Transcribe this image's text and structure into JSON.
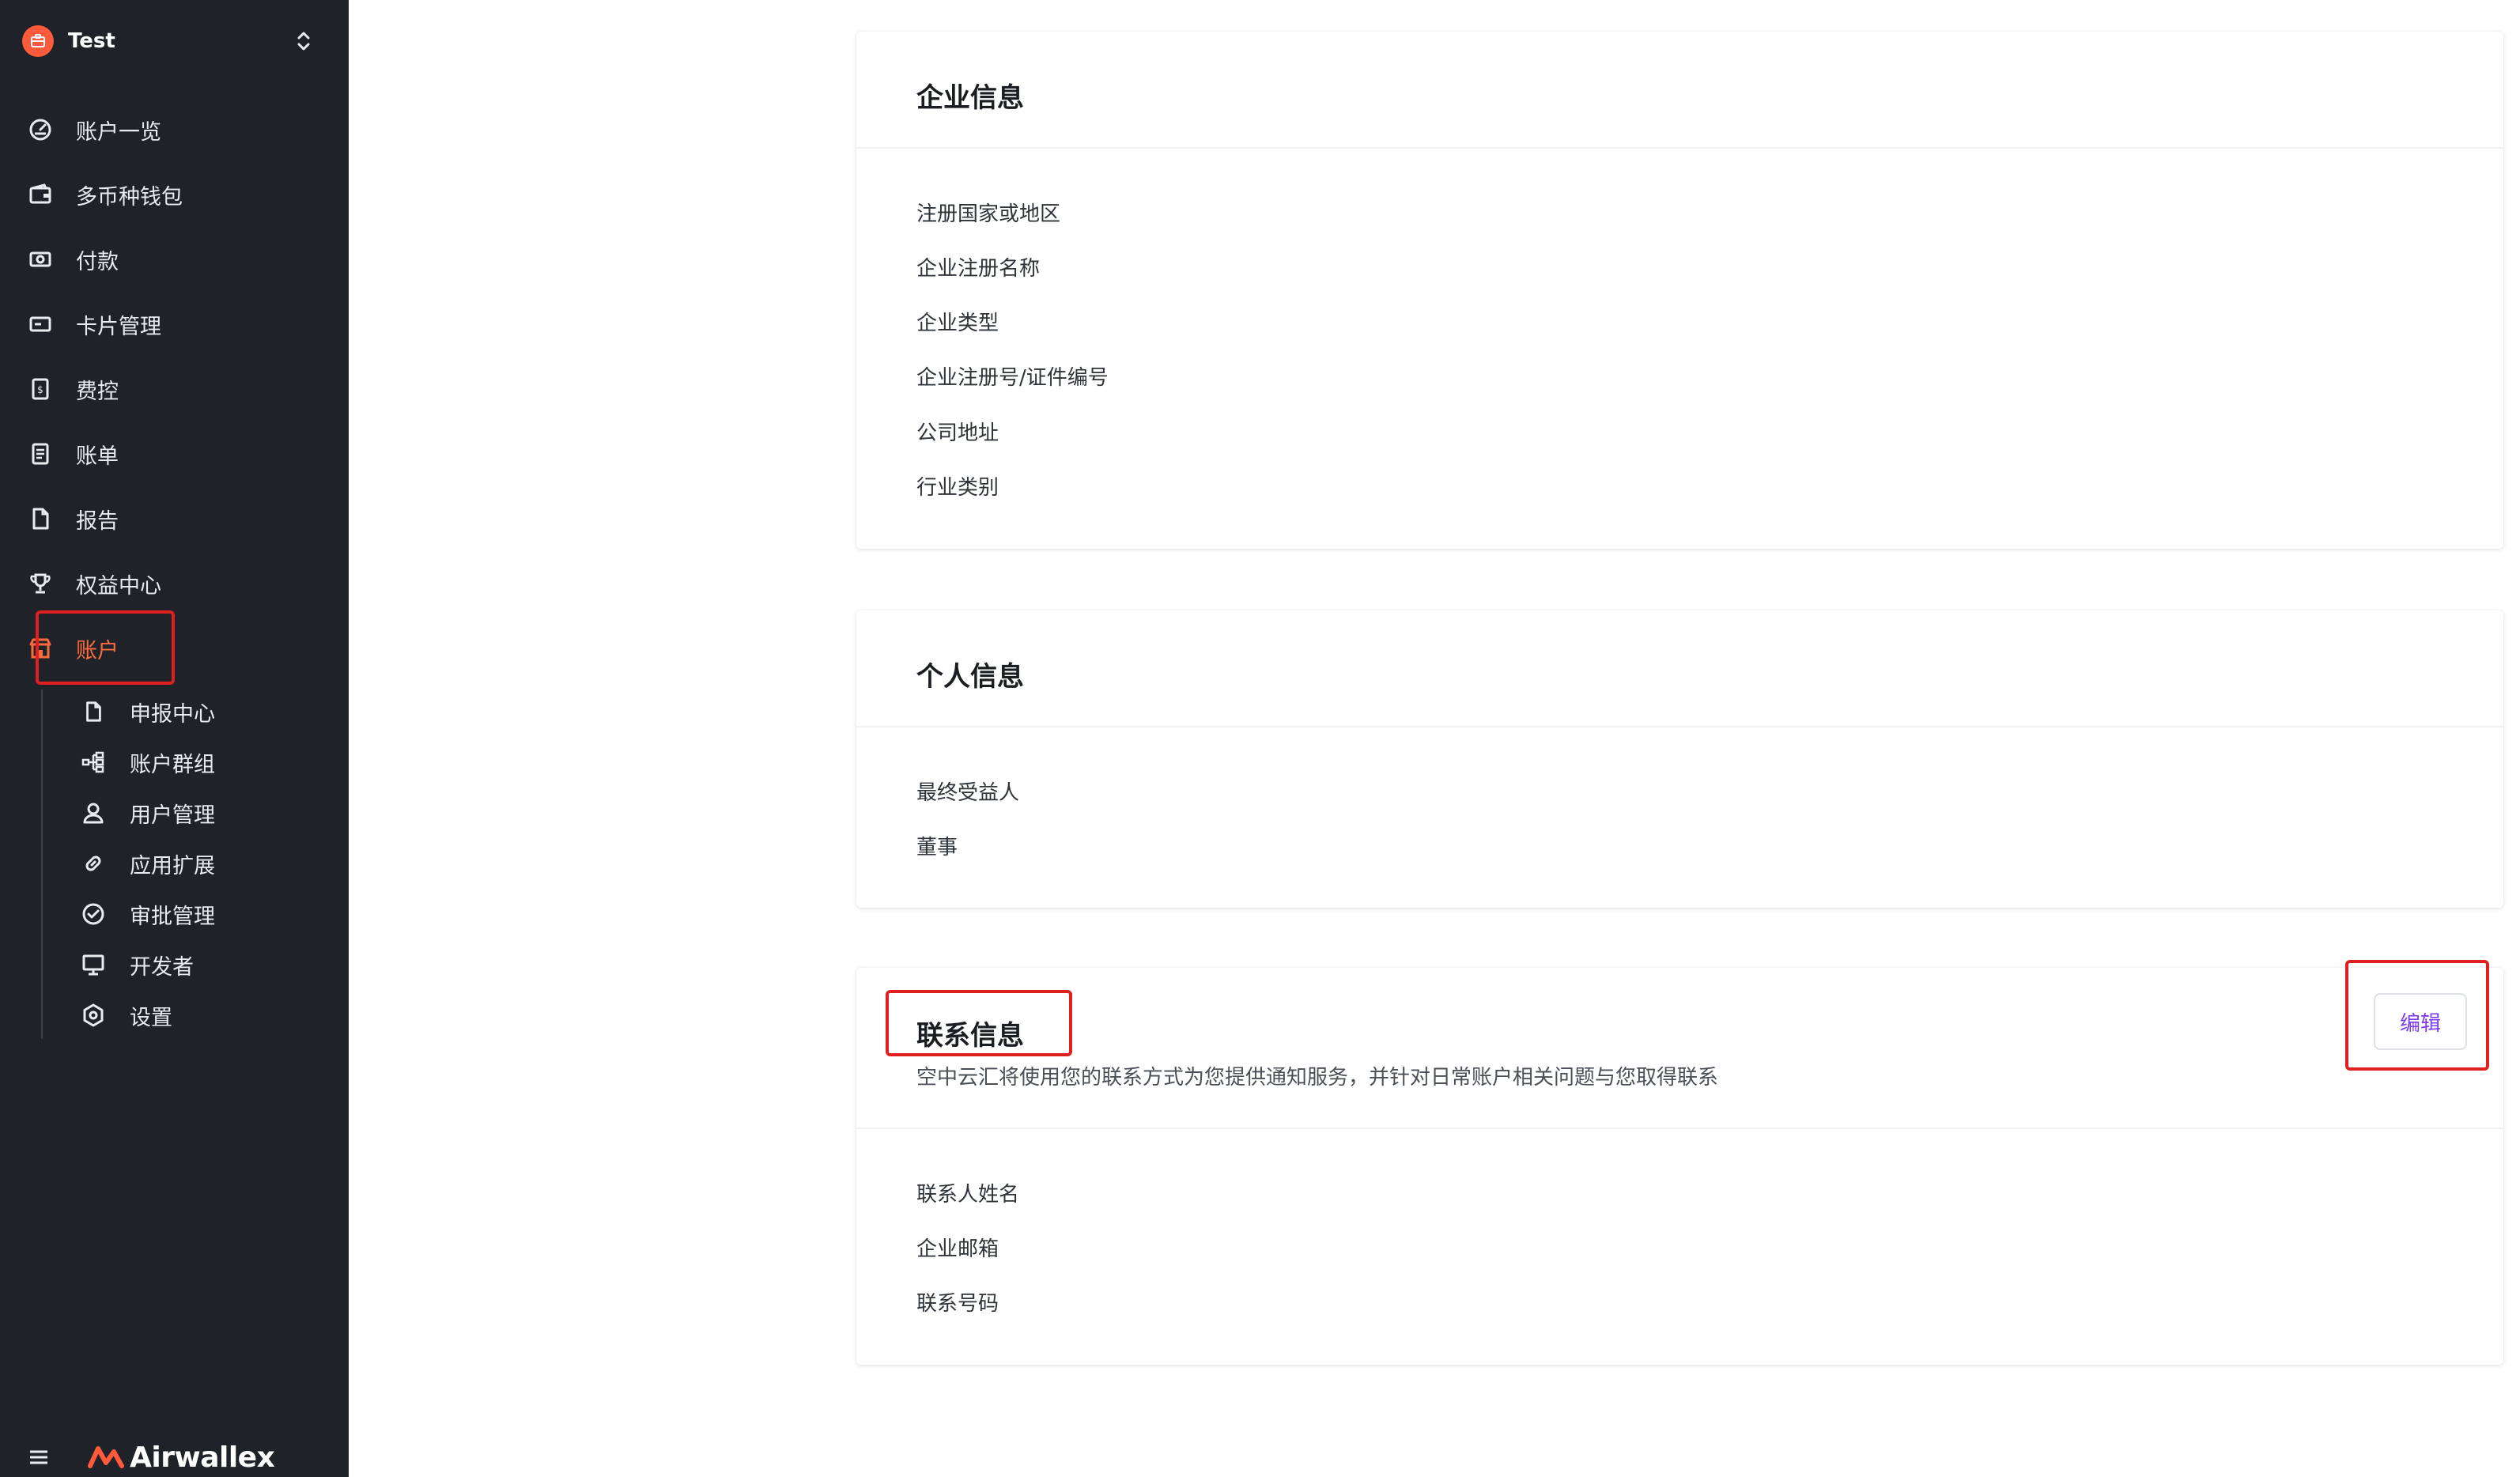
{
  "workspace": {
    "name": "Test",
    "icon": "briefcase-icon"
  },
  "sidebar": {
    "items": [
      {
        "label": "账户一览",
        "icon": "dashboard-icon"
      },
      {
        "label": "多币种钱包",
        "icon": "wallet-icon"
      },
      {
        "label": "付款",
        "icon": "payment-icon"
      },
      {
        "label": "卡片管理",
        "icon": "card-icon"
      },
      {
        "label": "费控",
        "icon": "expense-icon"
      },
      {
        "label": "账单",
        "icon": "bill-icon"
      },
      {
        "label": "报告",
        "icon": "report-icon"
      },
      {
        "label": "权益中心",
        "icon": "trophy-icon"
      },
      {
        "label": "账户",
        "icon": "store-icon",
        "active": true
      }
    ],
    "sub_items": [
      {
        "label": "申报中心",
        "icon": "document-icon"
      },
      {
        "label": "账户群组",
        "icon": "hierarchy-icon"
      },
      {
        "label": "用户管理",
        "icon": "user-icon"
      },
      {
        "label": "应用扩展",
        "icon": "link-icon"
      },
      {
        "label": "审批管理",
        "icon": "check-circle-icon"
      },
      {
        "label": "开发者",
        "icon": "monitor-icon"
      },
      {
        "label": "设置",
        "icon": "gear-icon"
      }
    ],
    "footer": {
      "brand": "Airwallex",
      "menu_icon": "hamburger-icon"
    }
  },
  "company_card": {
    "title": "企业信息",
    "fields": [
      "注册国家或地区",
      "企业注册名称",
      "企业类型",
      "企业注册号/证件编号",
      "公司地址",
      "行业类别"
    ]
  },
  "personal_card": {
    "title": "个人信息",
    "fields": [
      "最终受益人",
      "董事"
    ]
  },
  "contact_card": {
    "title": "联系信息",
    "description": "空中云汇将使用您的联系方式为您提供通知服务，并针对日常账户相关问题与您取得联系",
    "edit_label": "编辑",
    "fields": [
      "联系人姓名",
      "企业邮箱",
      "联系号码"
    ]
  },
  "colors": {
    "sidebar_bg": "#1f2329",
    "accent": "#ff6a3d",
    "edit_text": "#7a3cf0",
    "annotation": "#e02020"
  }
}
